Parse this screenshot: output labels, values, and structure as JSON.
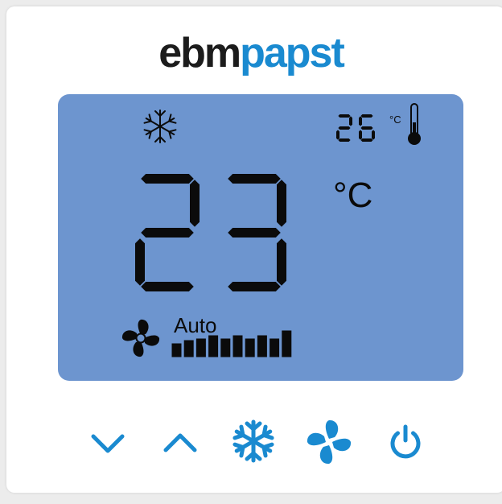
{
  "brand": {
    "part1": "ebm",
    "part2": "papst"
  },
  "display": {
    "set_temperature": "23",
    "set_unit": "°C",
    "room_temperature": "26",
    "room_unit": "°C",
    "mode_icon": "snowflake-icon",
    "fan_mode": "Auto",
    "fan_level": 1.0,
    "fan_segments": 10
  },
  "controls": [
    {
      "name": "decrease-button",
      "icon": "chevron-down-icon"
    },
    {
      "name": "increase-button",
      "icon": "chevron-up-icon"
    },
    {
      "name": "mode-button",
      "icon": "snowflake-icon"
    },
    {
      "name": "fan-button",
      "icon": "fan-icon"
    },
    {
      "name": "power-button",
      "icon": "power-icon"
    }
  ],
  "colors": {
    "accent": "#1a8ad0",
    "lcd_background": "#6d95cf",
    "lcd_ink": "#0b0b0b"
  }
}
